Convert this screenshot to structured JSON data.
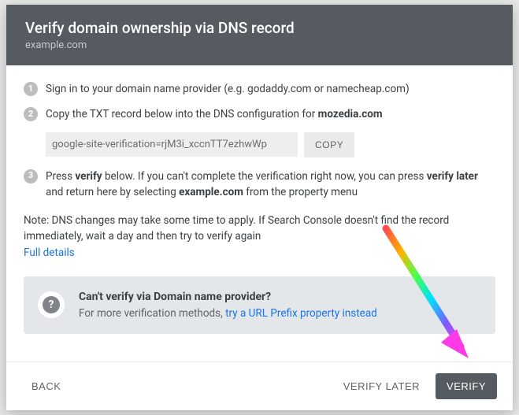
{
  "header": {
    "title": "Verify domain ownership via DNS record",
    "subtitle": "example.com"
  },
  "steps": {
    "s1": "Sign in to your domain name provider (e.g. godaddy.com or namecheap.com)",
    "s2_prefix": "Copy the TXT record below into the DNS configuration for ",
    "s2_bold": "mozedia.com",
    "txt_record": "google-site-verification=rjM3i_xccnTT7ezhwWp",
    "copy_label": "COPY",
    "s3_a": "Press ",
    "s3_b": "verify",
    "s3_c": " below. If you can't complete the verification right now, you can press ",
    "s3_d": "verify later",
    "s3_e": " and return here by selecting ",
    "s3_f": "example.com",
    "s3_g": " from the property menu"
  },
  "note": {
    "text": "Note: DNS changes may take some time to apply. If Search Console doesn't find the record immediately, wait a day and then try to verify again",
    "link": "Full details"
  },
  "info": {
    "title": "Can't verify via Domain name provider?",
    "sub_prefix": "For more verification methods, ",
    "sub_link": "try a URL Prefix property instead"
  },
  "footer": {
    "back": "BACK",
    "later": "VERIFY LATER",
    "verify": "VERIFY"
  }
}
